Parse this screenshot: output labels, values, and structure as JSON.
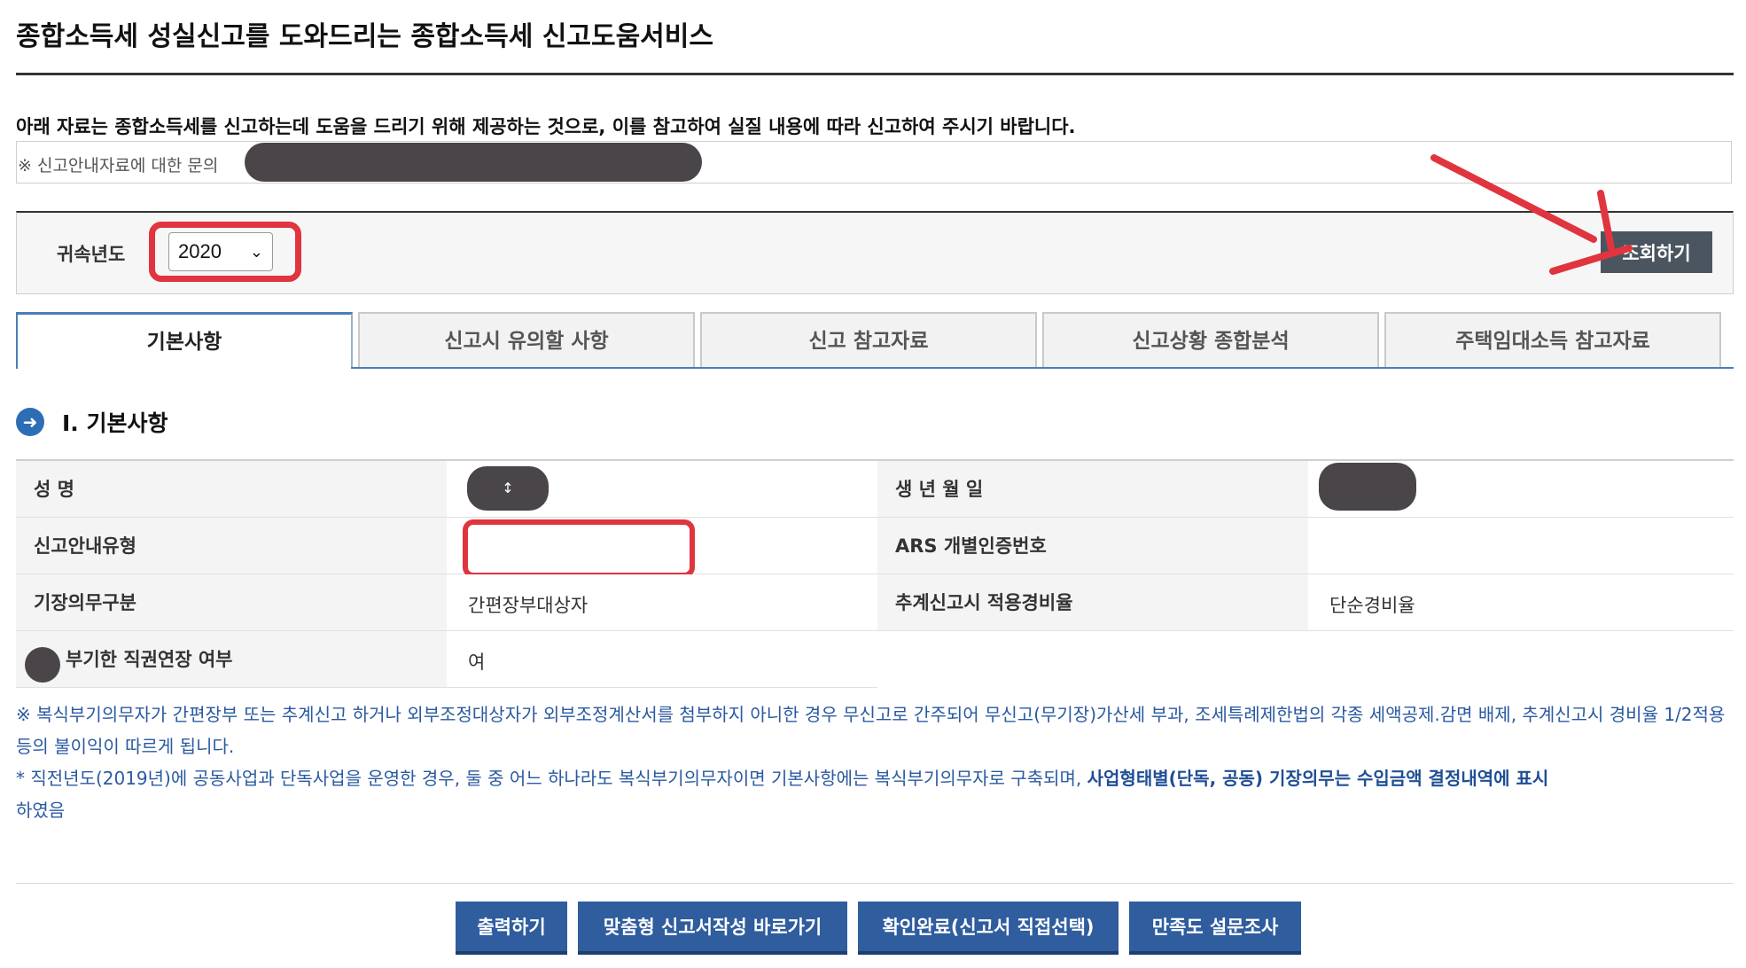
{
  "page": {
    "title": "종합소득세 성실신고를 도와드리는 종합소득세 신고도움서비스",
    "notice": "아래 자료는 종합소득세를 신고하는데 도움을 드리기 위해 제공하는 것으로, 이를 참고하여 실질 내용에 따라 신고하여 주시기 바랍니다.",
    "inquiry_label": "※ 신고안내자료에 대한 문의"
  },
  "search": {
    "year_label": "귀속년도",
    "year_value": "2020",
    "submit_label": "조회하기"
  },
  "tabs": [
    {
      "label": "기본사항",
      "active": true
    },
    {
      "label": "신고시 유의할 사항",
      "active": false
    },
    {
      "label": "신고 참고자료",
      "active": false
    },
    {
      "label": "신고상황 종합분석",
      "active": false
    },
    {
      "label": "주택임대소득 참고자료",
      "active": false
    }
  ],
  "section": {
    "icon": "arrow-right-circle-icon",
    "title": "Ⅰ. 기본사항"
  },
  "info": {
    "name_label": "성      명",
    "name_value": "",
    "birth_label": "생 년 월 일",
    "birth_value": "",
    "type_label": "신고안내유형",
    "type_value": "",
    "ars_label": "ARS 개별인증번호",
    "ars_value": "",
    "bookkeeping_label": "기장의무구분",
    "bookkeeping_value": "간편장부대상자",
    "rate_label": "추계신고시 적용경비율",
    "rate_value": "단순경비율",
    "extension_label": "부기한 직권연장 여부",
    "extension_value": "여"
  },
  "notes": {
    "line1": "※ 복식부기의무자가 간편장부 또는 추계신고 하거나 외부조정대상자가 외부조정계산서를 첨부하지 아니한 경우 무신고로 간주되어 무신고(무기장)가산세 부과, 조세특례제한법의 각종 세액공제.감면 배제, 추계신고시 경비율 1/2적용 등의 불이익이 따르게 됩니다.",
    "line2_plain": "* 직전년도(2019년)에 공동사업과 단독사업을 운영한 경우, 둘 중 어느 하나라도 복식부기의무자이면 기본사항에는 복식부기의무자로 구축되며,",
    "line2_bold": "사업형태별(단독, 공동) 기장의무는 수입금액 결정내역에 표시",
    "line2_end": "하였음"
  },
  "buttons": {
    "print": "출력하기",
    "custom_form": "맞춤형 신고서작성 바로가기",
    "confirm": "확인완료(신고서 직접선택)",
    "survey": "만족도 설문조사"
  },
  "colors": {
    "accent_blue": "#2f5d9e",
    "highlight_red": "#e0343f",
    "dark_button": "#4a5560"
  }
}
